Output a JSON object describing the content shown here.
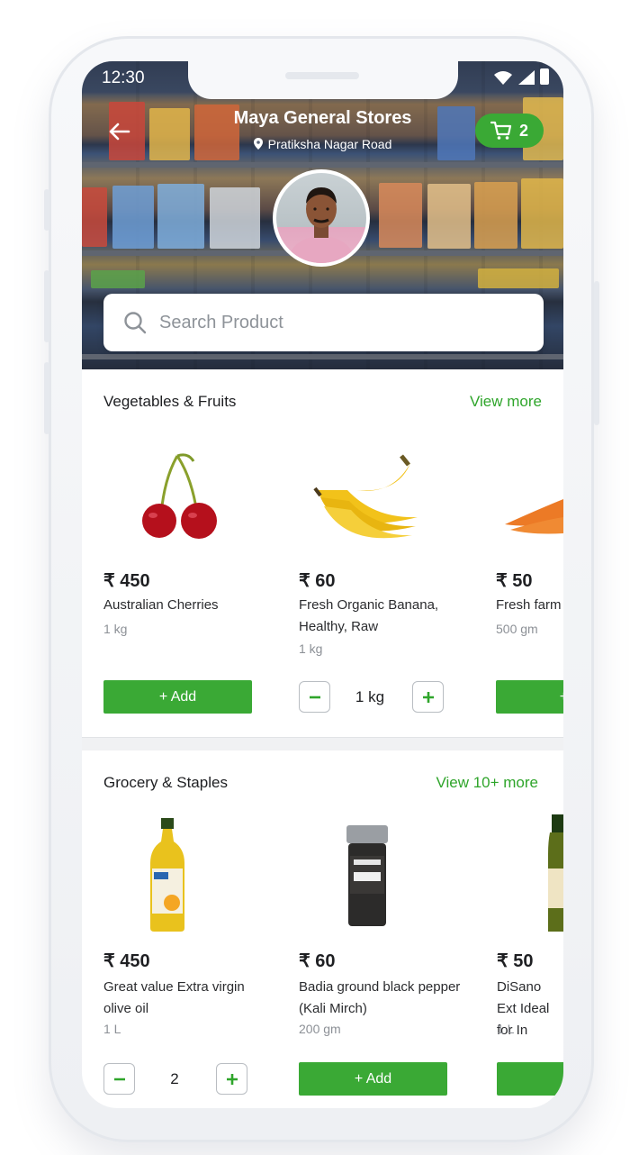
{
  "status": {
    "time": "12:30"
  },
  "store": {
    "name": "Maya General Stores",
    "location": "Pratiksha Nagar Road"
  },
  "cart": {
    "count": "2"
  },
  "search": {
    "placeholder": "Search Product"
  },
  "sections": [
    {
      "title": "Vegetables & Fruits",
      "more": "View more",
      "products": [
        {
          "price": "₹ 450",
          "name": "Australian Cherries",
          "qty": "1 kg",
          "action": "+ Add"
        },
        {
          "price": "₹ 60",
          "name": "Fresh Organic Banana, Healthy, Raw",
          "qty": "1 kg",
          "stepper": "1 kg"
        },
        {
          "price": "₹ 50",
          "name": "Fresh farm",
          "qty": "500 gm",
          "action": "+ A"
        }
      ]
    },
    {
      "title": "Grocery & Staples",
      "more": "View 10+ more",
      "products": [
        {
          "price": "₹ 450",
          "name": "Great value Extra virgin olive oil",
          "qty": "1 L",
          "stepper": "2"
        },
        {
          "price": "₹ 60",
          "name": "Badia ground black pepper (Kali Mirch)",
          "qty": "200 gm",
          "action": "+ Add"
        },
        {
          "price": "₹ 50",
          "name": "DiSano Ext Ideal for In",
          "qty": "1 L",
          "action": "+"
        }
      ]
    }
  ],
  "colors": {
    "accent": "#3aa935",
    "text": "#1e1f22"
  }
}
